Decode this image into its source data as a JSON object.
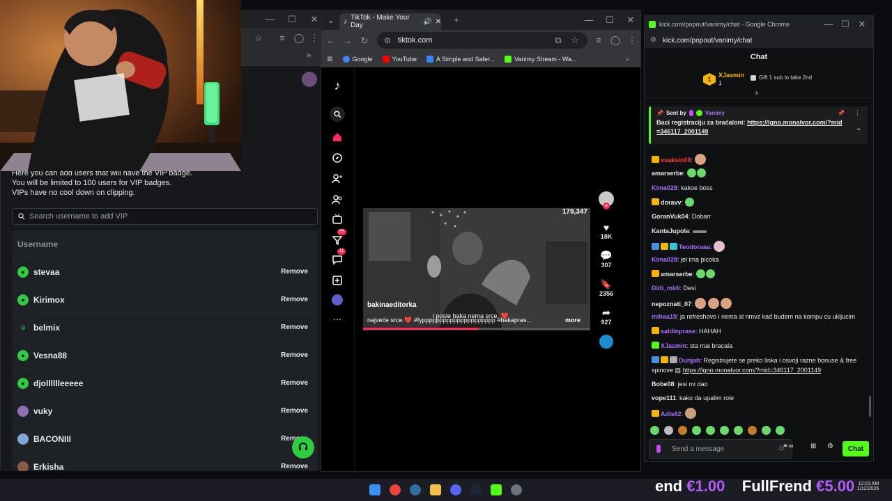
{
  "left_window": {
    "vip_info_lines": [
      "Here you can add users that will have the VIP badge.",
      "You will be limited to 100 users for VIP badges.",
      "VIPs have no cool down on clipping."
    ],
    "search_placeholder": "Search username to add VIP",
    "column_header": "Username",
    "remove_label": "Remove",
    "users": [
      "stevaa",
      "Kirimox",
      "belmix",
      "Vesna88",
      "djolllllleeeee",
      "vuky",
      "BACONIII",
      "Erkisha"
    ]
  },
  "tiktok_window": {
    "tab_title": "TikTok - Make Your Day",
    "url": "tiktok.com",
    "bookmarks": [
      "Google",
      "YouTube",
      "A Simple and Safer...",
      "Vanimy Stream - Wa..."
    ],
    "badges": {
      "activity": "55",
      "messages": "11"
    },
    "video": {
      "counter": "179,347",
      "author": "bakinaeditorka",
      "caption_overlay": "i posle baka nema srce. ❤️",
      "description": "najveće srce.❤️ #fyppppppppppppppppppppp #bakapras...",
      "more_label": "more"
    },
    "stats": {
      "likes": "18K",
      "comments": "307",
      "saves": "2356",
      "shares": "927"
    }
  },
  "kick_window": {
    "window_title": "kick.com/popout/vanimy/chat - Google Chrome",
    "url": "kick.com/popout/vanimy/chat",
    "header": "Chat",
    "top_gifter": {
      "rank": "1",
      "name": "XJasmin",
      "count": "1",
      "gift_cta": "Gift 1 sub to take 2nd"
    },
    "pinned": {
      "sent_by_label": "Sent by",
      "sender": "Vanimy",
      "text": "Baci registraciju za braćaloni: ",
      "link": "https://lgno.monalvor.com/?mid=346117_2001149"
    },
    "messages": [
      {
        "user": "vuaksin08",
        "text": "",
        "color": "#ff3b3b"
      },
      {
        "user": "amarserbe",
        "text": "",
        "color": "#e8e8e8"
      },
      {
        "user": "Kima028",
        "text": "kakoe boss",
        "color": "#a970ff"
      },
      {
        "user": "doravv",
        "text": "",
        "color": "#e8e8e8"
      },
      {
        "user": "GoranVuk04",
        "text": "Dobarr",
        "color": "#e8e8e8"
      },
      {
        "user": "KantaJupola",
        "text": "",
        "color": "#e8e8e8"
      },
      {
        "user": "Teodoraaa",
        "text": "",
        "color": "#a970ff"
      },
      {
        "user": "Kima028",
        "text": "jel ima picoka",
        "color": "#a970ff"
      },
      {
        "user": "amarserbe",
        "text": "",
        "color": "#e8e8e8"
      },
      {
        "user": "Didi_midi",
        "text": "Desi",
        "color": "#a970ff"
      },
      {
        "user": "nepoznati_07",
        "text": "",
        "color": "#e8e8e8"
      },
      {
        "user": "mihaa15",
        "text": "ja refreshovo i nema al nmvz kad budem na kompu cu ukljucim",
        "color": "#a970ff"
      },
      {
        "user": "saldinprase",
        "text": "HAHAH",
        "color": "#a970ff"
      },
      {
        "user": "XJasmin",
        "text": "sta mai bracala",
        "color": "#a970ff"
      },
      {
        "user": "Dunjah",
        "text": "Registrujete se preko linka i osvoji razne bonuse & free spinove",
        "link": "https://lgno.monalvor.com/?mid=346117_2001149",
        "color": "#a970ff"
      },
      {
        "user": "Bobe08",
        "text": "jesi mi dao",
        "color": "#e8e8e8"
      },
      {
        "user": "vope111",
        "text": "kako da upalim role",
        "color": "#e8e8e8"
      },
      {
        "user": "Adis62",
        "text": "",
        "color": "#a970ff"
      }
    ],
    "input_placeholder": "Send a message",
    "send_label": "Chat"
  },
  "taskbar": {
    "ticker": {
      "part1": "end",
      "price1": "€1.00",
      "part2": "FullFrend",
      "price2": "€5.00"
    },
    "clock": {
      "time": "12:23 AM",
      "date": "1/12/2026"
    }
  },
  "colors": {
    "kick_green": "#53fc18",
    "tiktok_red": "#fe2c55",
    "vip_green": "#2ecc40"
  }
}
